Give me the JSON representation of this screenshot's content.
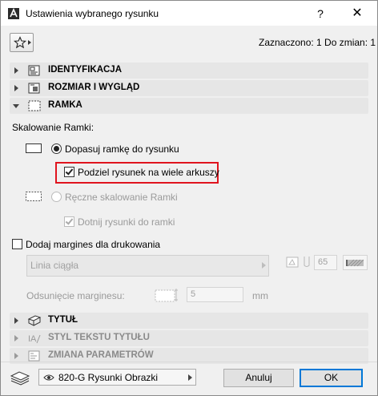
{
  "window": {
    "title": "Ustawienia wybranego rysunku",
    "help_label": "?",
    "close_label": "✕"
  },
  "header": {
    "favorites_icon": "star-icon",
    "status": "Zaznaczono: 1 Do zmian: 1"
  },
  "sections": {
    "identification": "IDENTYFIKACJA",
    "size_appearance": "ROZMIAR I WYGLĄD",
    "frame": "RAMKA",
    "title": "TYTUŁ",
    "title_text_style": "STYL TEKSTU TYTUŁU",
    "parameter_change": "ZMIANA PARAMETRÓW"
  },
  "frame_panel": {
    "scaling_label": "Skalowanie Ramki:",
    "fit_frame": {
      "label": "Dopasuj ramkę do rysunku",
      "checked": true
    },
    "split_drawing": {
      "label": "Podziel rysunek na wiele arkuszy",
      "checked": true
    },
    "manual_scaling": {
      "label": "Ręczne skalowanie Ramki",
      "checked": false,
      "disabled": true
    },
    "clip_drawing": {
      "label": "Dotnij rysunki do ramki",
      "checked": true,
      "disabled": true
    },
    "print_margins": {
      "label": "Dodaj margines dla drukowania",
      "checked": false
    },
    "line_type": "Linia ciągła",
    "pen_number": "65",
    "offset_label": "Odsunięcie marginesu:",
    "offset_value": "5",
    "offset_unit": "mm"
  },
  "footer": {
    "layer": "820-G Rysunki Obrazki",
    "cancel_label": "Anuluj",
    "ok_label": "OK"
  },
  "colors": {
    "highlight": "#e0141e",
    "section_bg": "#e6e6e6",
    "default_button_border": "#0078d7"
  }
}
